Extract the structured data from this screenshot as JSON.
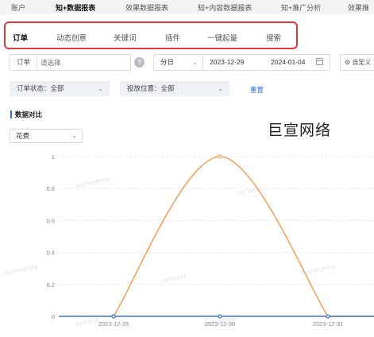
{
  "top_nav": {
    "items": [
      {
        "label": "账户",
        "active": false
      },
      {
        "label": "知+数据报表",
        "active": true
      },
      {
        "label": "效果数据报表",
        "active": false
      },
      {
        "label": "知+内容数据报表",
        "active": false
      },
      {
        "label": "知+推广分析",
        "active": false
      },
      {
        "label": "效果推",
        "active": false
      }
    ]
  },
  "sub_tabs": {
    "items": [
      {
        "label": "订单",
        "active": true
      },
      {
        "label": "动态创意",
        "active": false
      },
      {
        "label": "关键词",
        "active": false
      },
      {
        "label": "插件",
        "active": false
      },
      {
        "label": "一键起量",
        "active": false
      },
      {
        "label": "搜索",
        "active": false
      }
    ],
    "highlight_color": "#e23a3a"
  },
  "filters": {
    "order_label": "订单",
    "order_placeholder": "请选择",
    "granularity": "分日",
    "date_start": "2023-12-29",
    "date_end": "2024-01-04",
    "custom_label": "自定义",
    "order_status": "订单状态：全部",
    "placement": "投放位置：全部",
    "reset": "重置"
  },
  "section": {
    "title": "数据对比",
    "metric": "花费",
    "brand_text": "巨宣网络"
  },
  "chart_data": {
    "type": "line",
    "x": [
      "2023-12-29",
      "2023-12-30",
      "2023-12-31"
    ],
    "y_ticks": [
      "0",
      "0.2",
      "0.4",
      "0.6",
      "0.8",
      "1"
    ],
    "ylim": [
      0,
      1
    ],
    "series": [
      {
        "values": [
          0,
          1,
          0
        ],
        "color": "#f5a05a"
      },
      {
        "values": [
          0,
          0,
          0
        ],
        "color": "#3b74e6"
      }
    ]
  },
  "watermarks": [
    "Jiuchanghong",
    "19778611"
  ]
}
